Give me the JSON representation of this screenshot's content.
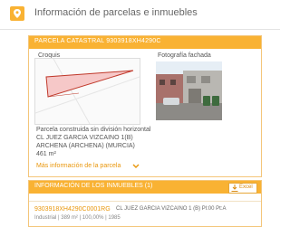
{
  "header": {
    "title": "Información de parcelas e inmuebles",
    "icon": "map-pin-icon"
  },
  "parcel": {
    "bar_title": "PARCELA CATASTRAL 9303918XH4290C",
    "croquis_label": "Croquis",
    "photo_label": "Fotografía fachada",
    "line1": "Parcela construida sin división horizontal",
    "line2": "CL JUEZ GARCIA VIZCAINO 1(B)",
    "line3": "ARCHENA (ARCHENA) (MURCIA)",
    "area": "461 m²",
    "more_link": "Más información de la parcela"
  },
  "inmuebles": {
    "bar_title": "INFORMACIÓN DE LOS INMUEBLES (1)",
    "excel_label": "Excel",
    "rows": [
      {
        "ref": "9303918XH4290C0001RG",
        "address": "CL JUEZ GARCIA VIZCAINO 1 (B) Pl:00 Pt:A",
        "detail": "Industrial | 389 m² | 100,00% | 1985"
      }
    ]
  },
  "colors": {
    "accent": "#f9b233",
    "link": "#e9960a",
    "parcel_fill": "#f6c8c8",
    "parcel_stroke": "#c0392b"
  }
}
